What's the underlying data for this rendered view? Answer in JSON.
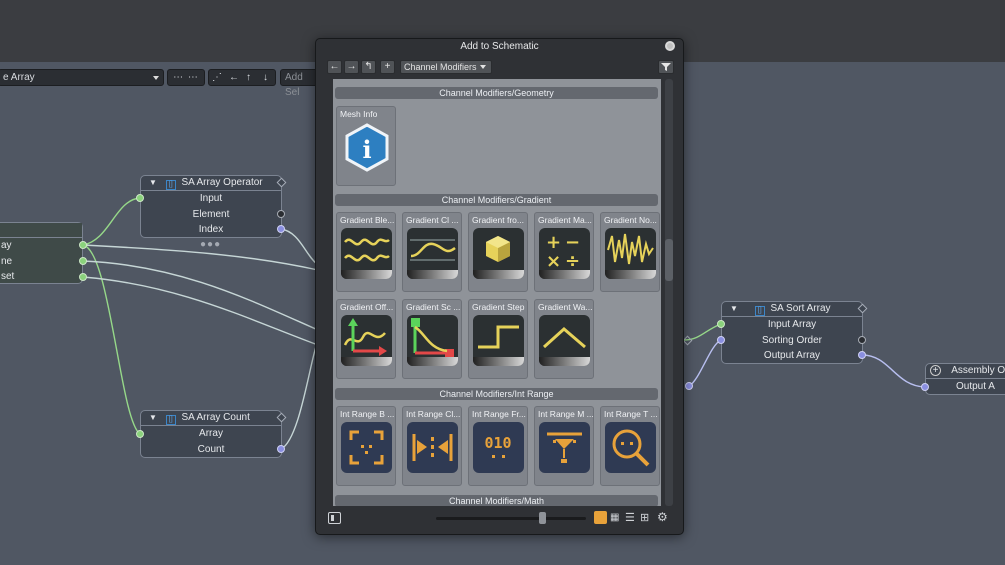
{
  "toolbar": {
    "array_select": "e Array",
    "add_sel": "Add Sel"
  },
  "nodes": {
    "op": {
      "title": "SA Array Operator",
      "rows": [
        "Input",
        "Element",
        "Index"
      ]
    },
    "count": {
      "title": "SA Array Count",
      "rows": [
        "Array",
        "Count"
      ]
    },
    "sort": {
      "title": "SA Sort Array",
      "rows": [
        "Input Array",
        "Sorting Order",
        "Output Array"
      ]
    },
    "assembly": {
      "title": "Assembly Out",
      "rows": [
        "Output A"
      ]
    },
    "left": {
      "rows": [
        "ay",
        "ne",
        "set"
      ]
    }
  },
  "dialog": {
    "title": "Add to Schematic",
    "dropdown": "Channel Modifiers",
    "sections": [
      "Channel Modifiers/Geometry",
      "Channel Modifiers/Gradient",
      "Channel Modifiers/Int Range",
      "Channel Modifiers/Math"
    ],
    "tiles": {
      "geometry": [
        "Mesh Info"
      ],
      "gradient": [
        "Gradient Ble...",
        "Gradient Cl ...",
        "Gradient fro...",
        "Gradient Ma...",
        "Gradient No...",
        "Gradient Off...",
        "Gradient Sc ...",
        "Gradient Step",
        "Gradient Wa..."
      ],
      "intrange": [
        "Int Range B ...",
        "Int Range Cl...",
        "Int Range Fr...",
        "Int Range M ...",
        "Int Range T ..."
      ]
    }
  },
  "colors": {
    "accent_orange": "#e8a23a",
    "port_green": "#8ad27c",
    "port_blue": "#8a8fe0",
    "icon_yellow": "#e6d25a"
  }
}
